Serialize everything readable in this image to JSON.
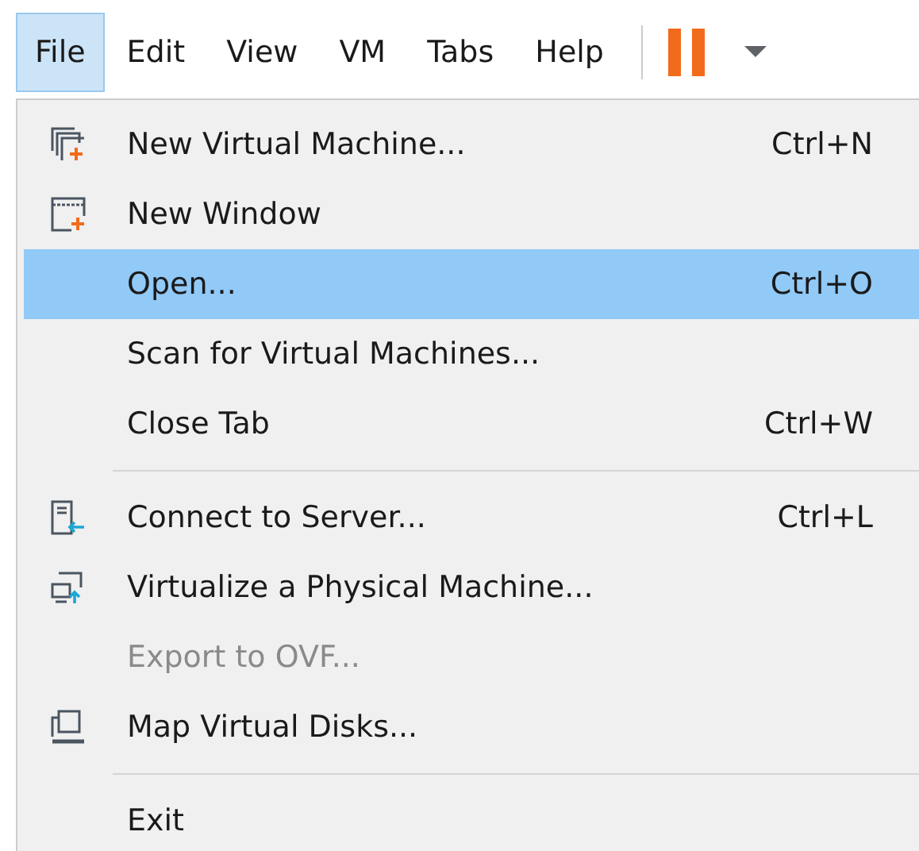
{
  "menubar": [
    {
      "label": "File",
      "selected": true
    },
    {
      "label": "Edit",
      "selected": false
    },
    {
      "label": "View",
      "selected": false
    },
    {
      "label": "VM",
      "selected": false
    },
    {
      "label": "Tabs",
      "selected": false
    },
    {
      "label": "Help",
      "selected": false
    }
  ],
  "menu": [
    {
      "kind": "item",
      "label": "New Virtual Machine...",
      "shortcut": "Ctrl+N",
      "selected": false,
      "disabled": false
    },
    {
      "kind": "item",
      "label": "New Window",
      "selected": false,
      "disabled": false
    },
    {
      "kind": "item",
      "label": "Open...",
      "shortcut": "Ctrl+O",
      "selected": true,
      "disabled": false
    },
    {
      "kind": "item",
      "label": "Scan for Virtual Machines...",
      "selected": false,
      "disabled": false
    },
    {
      "kind": "item",
      "label": "Close Tab",
      "shortcut": "Ctrl+W",
      "selected": false,
      "disabled": false
    },
    {
      "kind": "separator"
    },
    {
      "kind": "item",
      "label": "Connect to Server...",
      "shortcut": "Ctrl+L",
      "selected": false,
      "disabled": false
    },
    {
      "kind": "item",
      "label": "Virtualize a Physical Machine...",
      "selected": false,
      "disabled": false
    },
    {
      "kind": "item",
      "label": "Export to OVF...",
      "selected": false,
      "disabled": true
    },
    {
      "kind": "item",
      "label": "Map Virtual Disks...",
      "selected": false,
      "disabled": false
    },
    {
      "kind": "separator"
    },
    {
      "kind": "item",
      "label": "Exit",
      "selected": false,
      "disabled": false
    }
  ]
}
